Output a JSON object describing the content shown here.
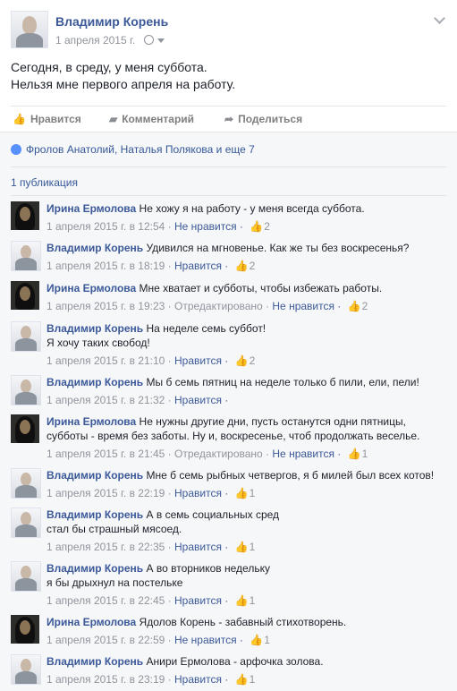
{
  "post": {
    "author": "Владимир Корень",
    "date": "1 апреля 2015 г.",
    "text_line1": "Сегодня, в среду, у меня суббота.",
    "text_line2": "Нельзя мне первого апреля на работу."
  },
  "actions": {
    "like": "Нравится",
    "comment": "Комментарий",
    "share": "Поделиться"
  },
  "likes_summary": "Фролов Анатолий, Наталья Полякова и еще 7",
  "comments_count": "1 публикация",
  "comments": [
    {
      "author": "Ирина Ермолова",
      "text": "Не хожу я на работу - у меня всегда суббота.",
      "line2": "",
      "date": "1 апреля 2015 г. в 12:54",
      "edited": "",
      "action": "Не нравится",
      "likes": "2"
    },
    {
      "author": "Владимир Корень",
      "text": "Удивился на мгновенье. Как же ты без воскресенья?",
      "line2": "",
      "date": "1 апреля 2015 г. в 18:19",
      "edited": "",
      "action": "Нравится",
      "likes": "2"
    },
    {
      "author": "Ирина Ермолова",
      "text": "Мне хватает и субботы, чтобы избежать работы.",
      "line2": "",
      "date": "1 апреля 2015 г. в 19:23",
      "edited": "Отредактировано",
      "action": "Не нравится",
      "likes": "2"
    },
    {
      "author": "Владимир Корень",
      "text": "На неделе семь суббот!",
      "line2": "Я хочу таких свобод!",
      "date": "1 апреля 2015 г. в 21:10",
      "edited": "",
      "action": "Нравится",
      "likes": "2"
    },
    {
      "author": "Владимир Корень",
      "text": "Мы б семь пятниц на неделе только б пили, ели, пели!",
      "line2": "",
      "date": "1 апреля 2015 г. в 21:32",
      "edited": "",
      "action": "Нравится",
      "likes": ""
    },
    {
      "author": "Ирина Ермолова",
      "text": "Не нужны другие дни, пусть останутся одни пятницы,",
      "line2": "субботы - время без заботы. Ну и, воскресенье, чтоб продолжать веселье.",
      "date": "1 апреля 2015 г. в 21:45",
      "edited": "Отредактировано",
      "action": "Не нравится",
      "likes": "1"
    },
    {
      "author": "Владимир Корень",
      "text": "Мне б семь рыбных четвергов, я б милей был всех котов!",
      "line2": "",
      "date": "1 апреля 2015 г. в 22:19",
      "edited": "",
      "action": "Нравится",
      "likes": "1"
    },
    {
      "author": "Владимир Корень",
      "text": "А в семь социальных сред",
      "line2": "стал бы страшный мясоед.",
      "date": "1 апреля 2015 г. в 22:35",
      "edited": "",
      "action": "Нравится",
      "likes": "1"
    },
    {
      "author": "Владимир Корень",
      "text": "А во вторников недельку",
      "line2": "я бы дрыхнул на постельке",
      "date": "1 апреля 2015 г. в 22:45",
      "edited": "",
      "action": "Нравится",
      "likes": "1"
    },
    {
      "author": "Ирина Ермолова",
      "text": "Ядолов Корень - забавный стихотворень.",
      "line2": "",
      "date": "1 апреля 2015 г. в 22:59",
      "edited": "",
      "action": "Не нравится",
      "likes": "1"
    },
    {
      "author": "Владимир Корень",
      "text": "Анири Ермолова - арфочка золова.",
      "line2": "",
      "date": "1 апреля 2015 г. в 23:19",
      "edited": "",
      "action": "Нравится",
      "likes": "1"
    }
  ]
}
